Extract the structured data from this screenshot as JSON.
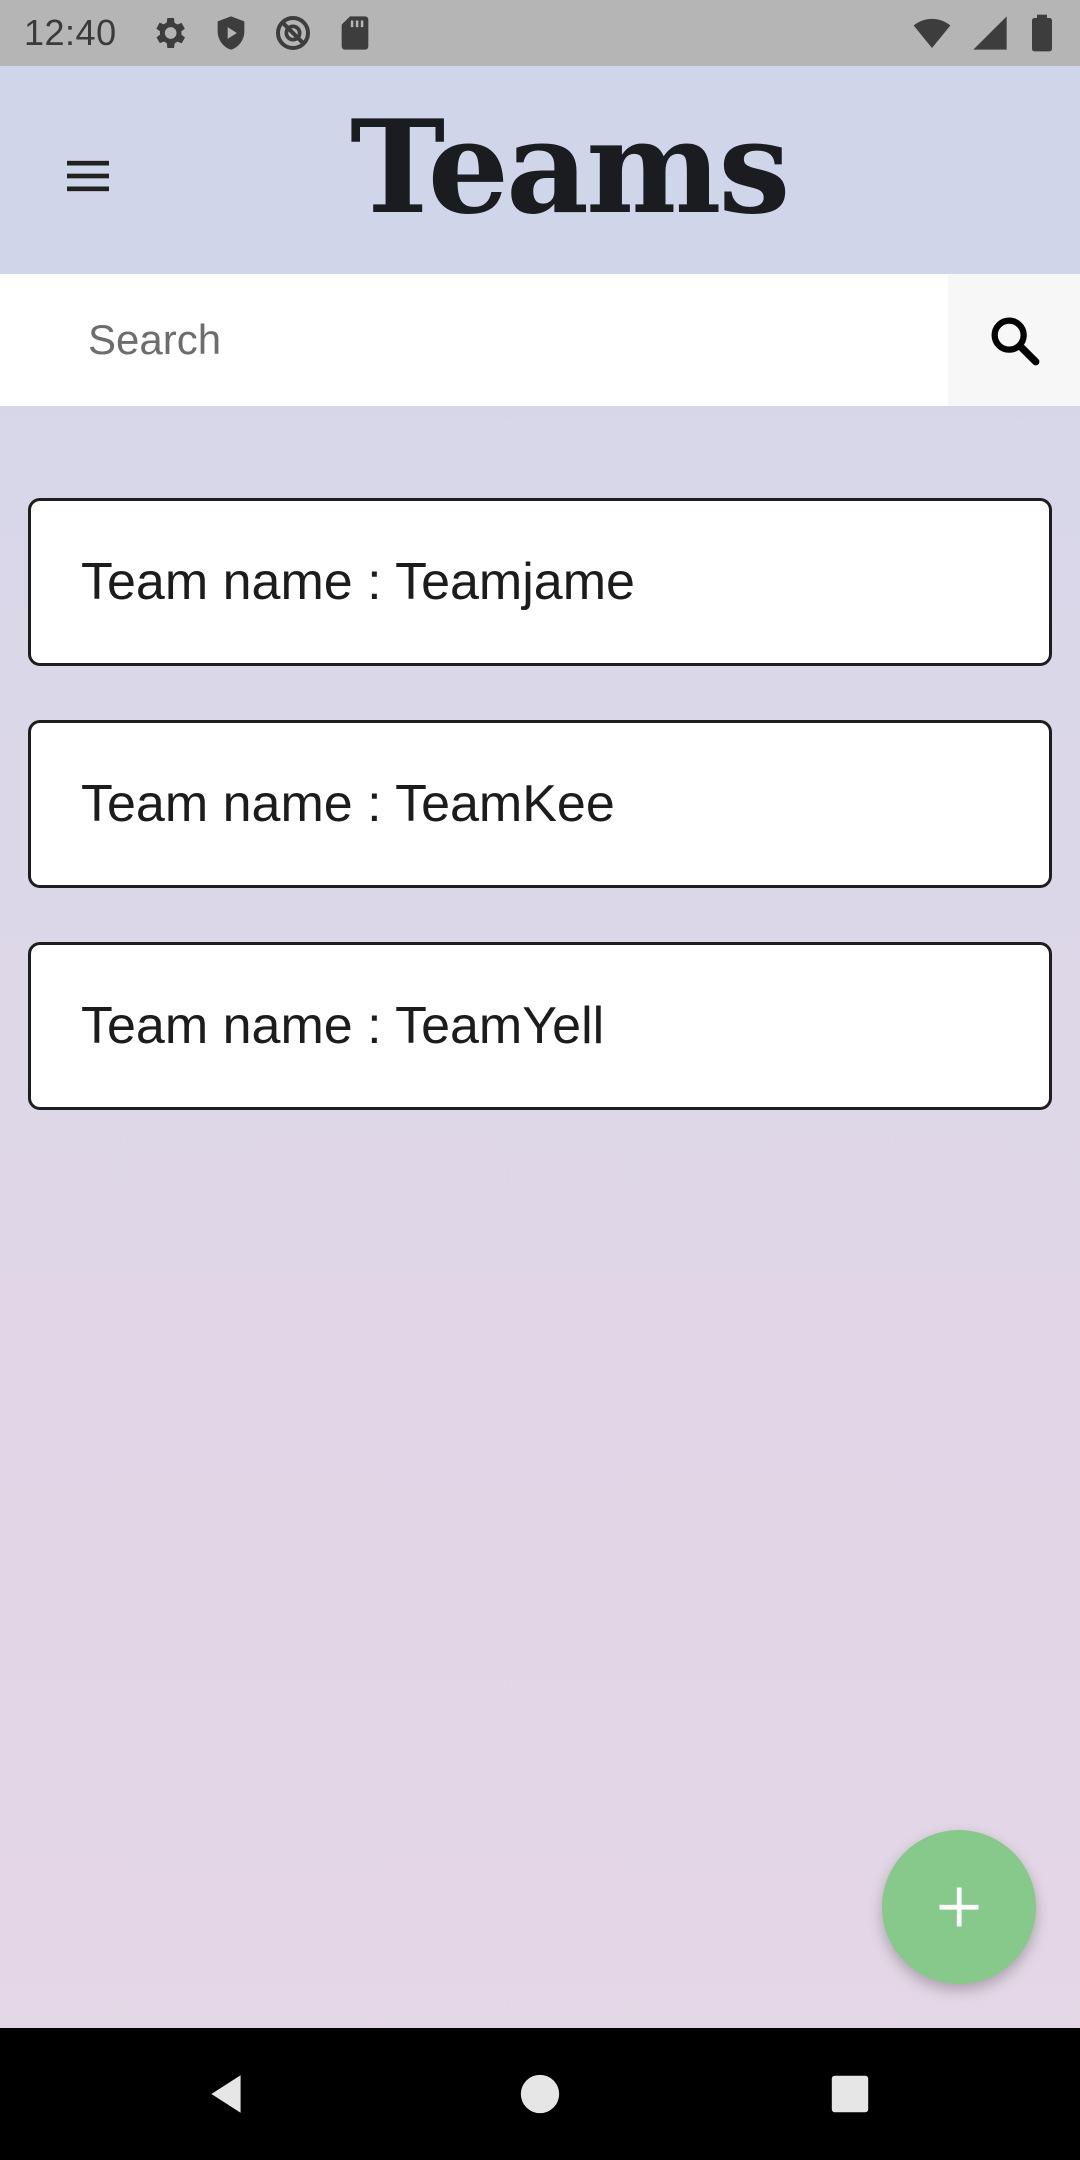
{
  "status_bar": {
    "time": "12:40",
    "left_icons": [
      "settings-gear-icon",
      "shield-icon",
      "blocked-circle-icon",
      "sd-card-icon"
    ],
    "right_icons": [
      "wifi-icon",
      "signal-icon",
      "battery-icon"
    ]
  },
  "app_bar": {
    "title": "Teams",
    "menu_icon": "hamburger-menu-icon",
    "background": "#d0d6ea"
  },
  "search": {
    "placeholder": "Search",
    "value": "",
    "button_icon": "search-icon"
  },
  "teams": [
    {
      "label": "Team name : Teamjame"
    },
    {
      "label": "Team name : TeamKee"
    },
    {
      "label": "Team name : TeamYell"
    }
  ],
  "fab": {
    "icon": "plus-icon",
    "color": "#86c98a"
  },
  "nav_bar": {
    "buttons": [
      "back-icon",
      "home-icon",
      "recents-icon"
    ]
  }
}
